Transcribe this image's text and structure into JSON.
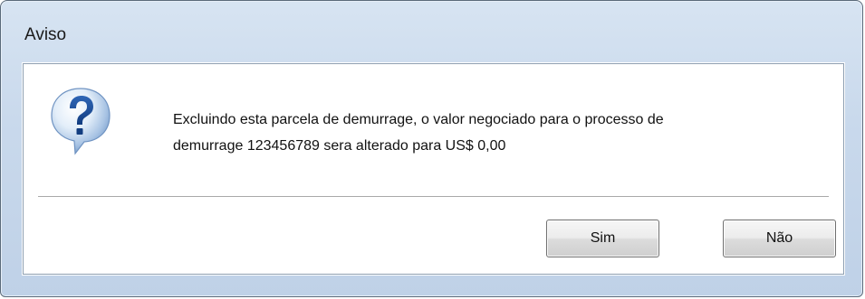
{
  "window": {
    "title": "Aviso"
  },
  "dialog": {
    "icon": "question-mark-icon",
    "message_line1": "Excluindo esta parcela de demurrage, o valor negociado para o processo de",
    "message_line2": "demurrage 123456789 sera alterado para US$ 0,00"
  },
  "buttons": {
    "yes_label": "Sim",
    "no_label": "Não"
  },
  "colors": {
    "titlebar": "#c9d9ec",
    "client_background": "#ffffff",
    "icon_blue": "#1b4f9c"
  }
}
